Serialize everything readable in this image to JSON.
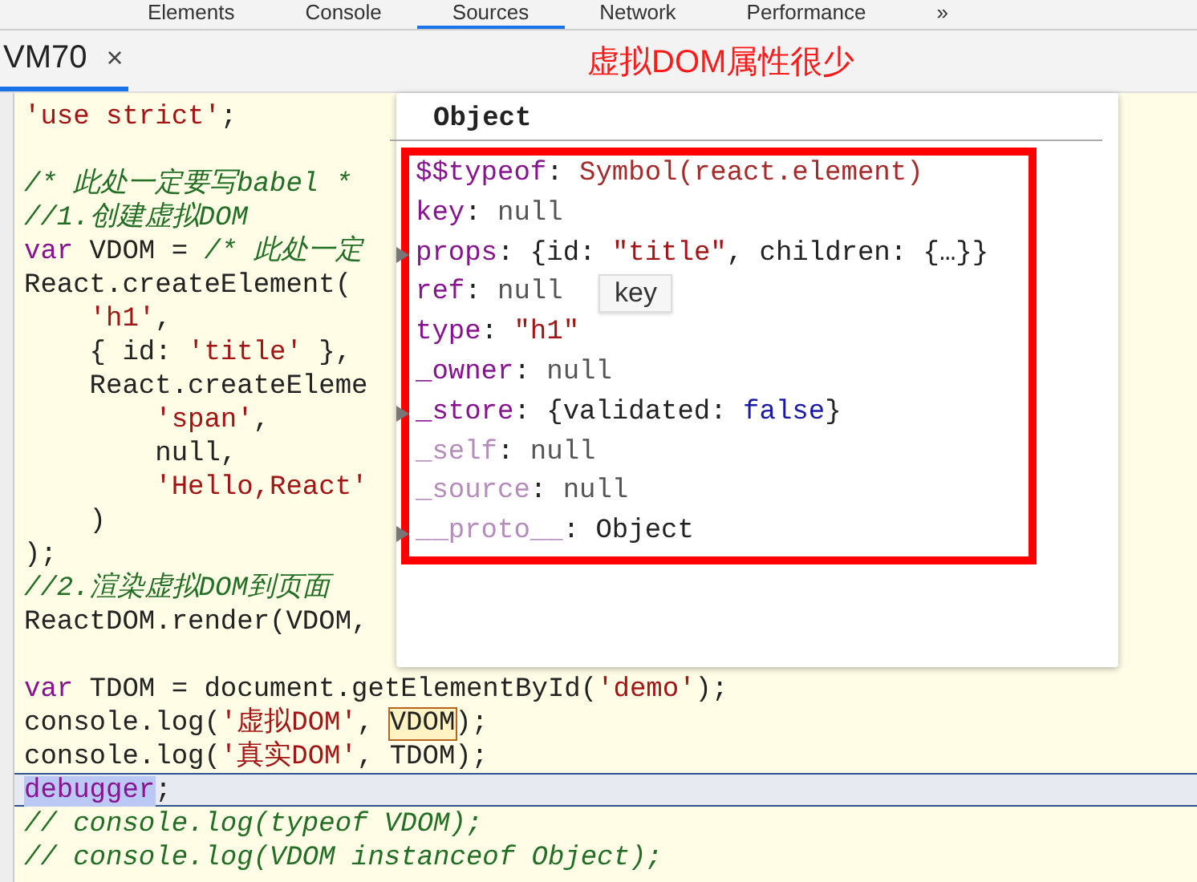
{
  "devtools_tabs": [
    {
      "label": "Elements",
      "selected": false
    },
    {
      "label": "Console",
      "selected": false
    },
    {
      "label": "Sources",
      "selected": true
    },
    {
      "label": "Network",
      "selected": false
    },
    {
      "label": "Performance",
      "selected": false
    },
    {
      "label": "»",
      "selected": false
    }
  ],
  "file_tab": {
    "name": "VM70",
    "close": "×",
    "selected": true
  },
  "annotation": "虚拟DOM属性很少",
  "code_lines": [
    {
      "current": false,
      "tokens": [
        {
          "kind": "string",
          "text": "'use strict'"
        },
        {
          "kind": "plain",
          "text": ";"
        }
      ]
    },
    {
      "current": false
    },
    {
      "current": false,
      "tokens": [
        {
          "kind": "comment",
          "text": "/* 此处一定要写babel *"
        }
      ]
    },
    {
      "current": false,
      "tokens": [
        {
          "kind": "comment",
          "text": "//1.创建虚拟DOM"
        }
      ]
    },
    {
      "current": false,
      "tokens": [
        {
          "kind": "keyword",
          "text": "var"
        },
        {
          "kind": "plain",
          "text": " VDOM = "
        },
        {
          "kind": "comment",
          "text": "/* 此处一定"
        }
      ]
    },
    {
      "current": false,
      "tokens": [
        {
          "kind": "plain",
          "text": "React.createElement("
        }
      ]
    },
    {
      "current": false,
      "tokens": [
        {
          "kind": "string",
          "text": "    'h1'"
        },
        {
          "kind": "plain",
          "text": ","
        }
      ]
    },
    {
      "current": false,
      "tokens": [
        {
          "kind": "plain",
          "text": "    { id: "
        },
        {
          "kind": "string",
          "text": "'title'"
        },
        {
          "kind": "plain",
          "text": " },"
        }
      ]
    },
    {
      "current": false,
      "tokens": [
        {
          "kind": "plain",
          "text": "    React.createEleme"
        }
      ]
    },
    {
      "current": false,
      "tokens": [
        {
          "kind": "string",
          "text": "        'span'"
        },
        {
          "kind": "plain",
          "text": ","
        }
      ]
    },
    {
      "current": false,
      "tokens": [
        {
          "kind": "plain",
          "text": "        null,"
        }
      ]
    },
    {
      "current": false,
      "tokens": [
        {
          "kind": "string",
          "text": "        'Hello,React'"
        }
      ]
    },
    {
      "current": false,
      "tokens": [
        {
          "kind": "plain",
          "text": "    )"
        }
      ]
    },
    {
      "current": false,
      "tokens": [
        {
          "kind": "plain",
          "text": ");"
        }
      ]
    },
    {
      "current": false,
      "tokens": [
        {
          "kind": "comment",
          "text": "//2.渲染虚拟DOM到页面"
        }
      ]
    },
    {
      "current": false,
      "tokens": [
        {
          "kind": "plain",
          "text": "ReactDOM.render(VDOM,"
        }
      ]
    },
    {
      "current": false
    },
    {
      "current": false,
      "tokens": [
        {
          "kind": "keyword",
          "text": "var"
        },
        {
          "kind": "plain",
          "text": " TDOM = document.getElementById("
        },
        {
          "kind": "string",
          "text": "'demo'"
        },
        {
          "kind": "plain",
          "text": ");"
        }
      ]
    },
    {
      "current": false,
      "tokens": [
        {
          "kind": "plain",
          "text": "console.log("
        },
        {
          "kind": "string",
          "text": "'虚拟DOM'"
        },
        {
          "kind": "plain",
          "text": ", "
        },
        {
          "kind": "hover",
          "text": "VDOM"
        },
        {
          "kind": "plain",
          "text": ");"
        }
      ]
    },
    {
      "current": false,
      "tokens": [
        {
          "kind": "plain",
          "text": "console.log("
        },
        {
          "kind": "string",
          "text": "'真实DOM'"
        },
        {
          "kind": "plain",
          "text": ", TDOM);"
        }
      ]
    },
    {
      "current": true,
      "tokens": [
        {
          "kind": "keyword",
          "text": "debugger"
        },
        {
          "kind": "plain",
          "text": ";"
        }
      ]
    },
    {
      "current": false,
      "tokens": [
        {
          "kind": "comment",
          "text": "// console.log(typeof VDOM);"
        }
      ]
    },
    {
      "current": false,
      "tokens": [
        {
          "kind": "comment",
          "text": "// console.log(VDOM instanceof Object);"
        }
      ]
    }
  ],
  "popup": {
    "title": "Object",
    "properties": [
      {
        "key": "$$typeof",
        "dim": false,
        "expandable": false,
        "value": [
          {
            "kind": "plain",
            "text": ": "
          },
          {
            "kind": "symbol",
            "text": "Symbol(react.element)"
          }
        ]
      },
      {
        "key": "key",
        "dim": false,
        "expandable": false,
        "value": [
          {
            "kind": "plain",
            "text": ": "
          },
          {
            "kind": "null",
            "text": "null"
          }
        ]
      },
      {
        "key": "props",
        "dim": false,
        "expandable": true,
        "value": [
          {
            "kind": "plain",
            "text": ": {id: "
          },
          {
            "kind": "string",
            "text": "\"title\""
          },
          {
            "kind": "plain",
            "text": ", children: {…}}"
          }
        ]
      },
      {
        "key": "ref",
        "dim": false,
        "expandable": false,
        "value": [
          {
            "kind": "plain",
            "text": ": "
          },
          {
            "kind": "null",
            "text": "null"
          }
        ]
      },
      {
        "key": "type",
        "dim": false,
        "expandable": false,
        "value": [
          {
            "kind": "plain",
            "text": ": "
          },
          {
            "kind": "string",
            "text": "\"h1\""
          }
        ]
      },
      {
        "key": "_owner",
        "dim": false,
        "expandable": false,
        "value": [
          {
            "kind": "plain",
            "text": ": "
          },
          {
            "kind": "null",
            "text": "null"
          }
        ]
      },
      {
        "key": "_store",
        "dim": false,
        "expandable": true,
        "value": [
          {
            "kind": "plain",
            "text": ": {validated: "
          },
          {
            "kind": "bool",
            "text": "false"
          },
          {
            "kind": "plain",
            "text": "}"
          }
        ]
      },
      {
        "key": "_self",
        "dim": true,
        "expandable": false,
        "value": [
          {
            "kind": "plain",
            "text": ": "
          },
          {
            "kind": "null",
            "text": "null"
          }
        ]
      },
      {
        "key": "_source",
        "dim": true,
        "expandable": false,
        "value": [
          {
            "kind": "plain",
            "text": ": "
          },
          {
            "kind": "null",
            "text": "null"
          }
        ]
      },
      {
        "key": "__proto__",
        "dim": true,
        "expandable": true,
        "value": [
          {
            "kind": "plain",
            "text": ": Object"
          }
        ]
      }
    ],
    "tooltip": "key"
  }
}
